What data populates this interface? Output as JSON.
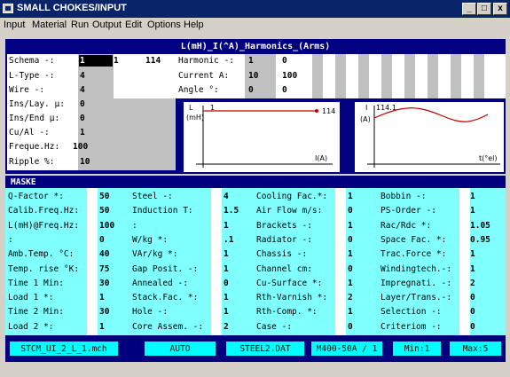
{
  "window": {
    "title": "SMALL CHOKES/INPUT"
  },
  "menu": [
    "Input",
    "Material",
    "Run",
    "Output",
    "Edit",
    "Options",
    "Help"
  ],
  "top": {
    "header": "L(mH)_I(^A)_Harmonics_(Arms)",
    "fields": [
      {
        "label": "Schema   -:",
        "value": "1"
      },
      {
        "label": "L-Type   -:",
        "value": "4"
      },
      {
        "label": "Wire     -:",
        "value": "4"
      },
      {
        "label": "Ins/Lay. µ:",
        "value": "0"
      },
      {
        "label": "Ins/End  µ:",
        "value": "0"
      },
      {
        "label": "Cu/Al    -:",
        "value": "1"
      },
      {
        "label": "Freque.Hz:",
        "value": "100"
      },
      {
        "label": "Ripple   %:",
        "value": "10"
      }
    ],
    "schema_extra": [
      "1",
      "114"
    ],
    "harmonic": {
      "label": "Harmonic  -:",
      "values": [
        "1",
        "0"
      ]
    },
    "current": {
      "label": "Current  A:",
      "values": [
        "10",
        "100"
      ]
    },
    "angle": {
      "label": "Angle   °:",
      "values": [
        "0",
        "0"
      ]
    }
  },
  "graph1": {
    "ylabel_top": "L",
    "ylabel": "(mH)",
    "start": "1",
    "end": "114",
    "xlabel": "I(A)"
  },
  "graph2": {
    "ylabel_top": "I",
    "value": "114.1",
    "ylabel": "(A)",
    "xlabel": "t(°el)"
  },
  "maske": {
    "title": "MASKE",
    "col1": [
      {
        "label": "Q-Factor     *:",
        "value": "50"
      },
      {
        "label": "Calib.Freq.Hz:",
        "value": "50"
      },
      {
        "label": "L(mH)@Freq.Hz:",
        "value": "100"
      },
      {
        "label": "            :",
        "value": "0"
      },
      {
        "label": "Amb.Temp.  °C:",
        "value": "40"
      },
      {
        "label": "Temp. rise °K:",
        "value": "75"
      },
      {
        "label": "Time 1    Min:",
        "value": "30"
      },
      {
        "label": "Load 1      *:",
        "value": "1"
      },
      {
        "label": "Time 2    Min:",
        "value": "30"
      },
      {
        "label": "Load 2      *:",
        "value": "1"
      }
    ],
    "col2": [
      {
        "label": "Steel       -:",
        "value": "4"
      },
      {
        "label": "Induction   T:",
        "value": "1.5"
      },
      {
        "label": "            :",
        "value": "1"
      },
      {
        "label": "W/kg        *:",
        "value": ".1"
      },
      {
        "label": "VAr/kg      *:",
        "value": "1"
      },
      {
        "label": "Gap Posit.  -:",
        "value": "1"
      },
      {
        "label": "Annealed    -:",
        "value": "0"
      },
      {
        "label": "Stack.Fac.  *:",
        "value": "1"
      },
      {
        "label": "Hole        -:",
        "value": "1"
      },
      {
        "label": "Core Assem. -:",
        "value": "2"
      }
    ],
    "col3": [
      {
        "label": "Cooling Fac.*:",
        "value": "1"
      },
      {
        "label": "Air Flow  m/s:",
        "value": "0"
      },
      {
        "label": "Brackets    -:",
        "value": "1"
      },
      {
        "label": "Radiator    -:",
        "value": "0"
      },
      {
        "label": "Chassis     -:",
        "value": "1"
      },
      {
        "label": "Channel    cm:",
        "value": "0"
      },
      {
        "label": "Cu-Surface  *:",
        "value": "1"
      },
      {
        "label": "Rth-Varnish *:",
        "value": "2"
      },
      {
        "label": "Rth-Comp.   *:",
        "value": "1"
      },
      {
        "label": "Case        -:",
        "value": "0"
      }
    ],
    "col4": [
      {
        "label": "Bobbin      -:",
        "value": "1"
      },
      {
        "label": "PS-Order    -:",
        "value": "1"
      },
      {
        "label": "Rac/Rdc     *:",
        "value": "1.05"
      },
      {
        "label": "Space Fac.  *:",
        "value": "0.95"
      },
      {
        "label": "Trac.Force  *:",
        "value": "1"
      },
      {
        "label": "Windingtech.-:",
        "value": "1"
      },
      {
        "label": "Impregnati. -:",
        "value": "2"
      },
      {
        "label": "Layer/Trans.-:",
        "value": "0"
      },
      {
        "label": "Selection   -:",
        "value": "0"
      },
      {
        "label": "Criteriom   -:",
        "value": "0"
      }
    ]
  },
  "status": [
    "STCM_UI_2_L_1.mch",
    "AUTO",
    "STEEL2.DAT",
    "M400-50A / 1",
    "Min:1",
    "Max:5"
  ]
}
